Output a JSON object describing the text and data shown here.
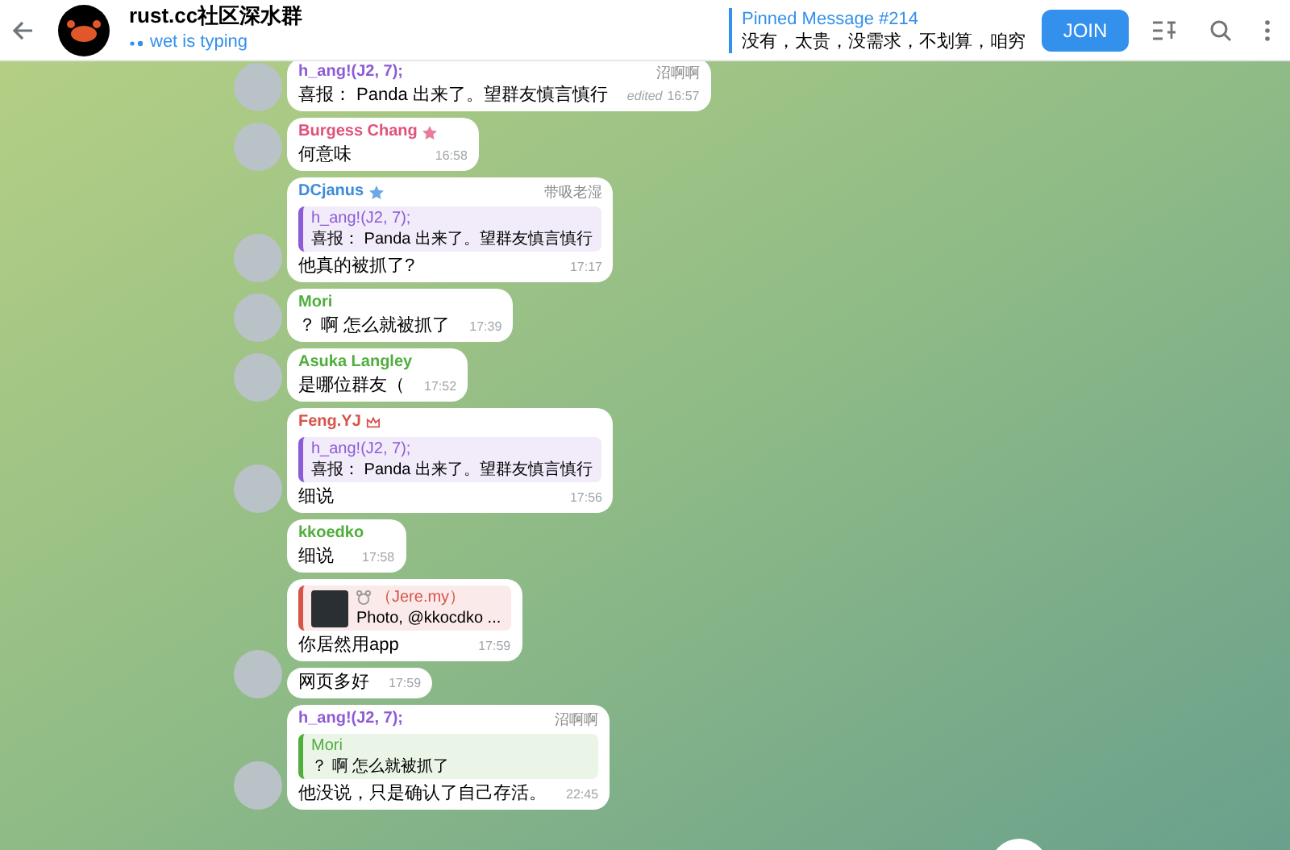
{
  "header": {
    "title": "rust.cc社区深水群",
    "status": "wet is typing",
    "pinned": {
      "label": "Pinned Message #214",
      "text": "没有，太贵，没需求，不划算，咱穷"
    },
    "join_button": "JOIN"
  },
  "messages": [
    {
      "sender": "h_ang!(J2, 7);",
      "color": "#8e5bd6",
      "star": false,
      "crown": false,
      "title": "沼啊啊",
      "text": "喜报： Panda 出来了。望群友慎言慎行",
      "edited": "edited",
      "time": "16:57",
      "avatar": true
    },
    {
      "sender": "Burgess Chang",
      "color": "#e0527a",
      "star": true,
      "crown": false,
      "text": "何意味",
      "time": "16:58",
      "avatar": true
    },
    {
      "sender": "DCjanus",
      "color": "#3e8bd8",
      "star": true,
      "crown": false,
      "title": "带吸老湿",
      "reply": {
        "sender": "h_ang!(J2, 7);",
        "color": "#8e5bd6",
        "text": "喜报： Panda 出来了。望群友慎言慎行"
      },
      "text": "他真的被抓了?",
      "time": "17:17",
      "avatar": true
    },
    {
      "sender": "Mori",
      "color": "#4fae3c",
      "star": false,
      "crown": false,
      "text": "？ 啊 怎么就被抓了",
      "time": "17:39",
      "avatar": true
    },
    {
      "sender": "Asuka Langley",
      "color": "#4fae3c",
      "star": false,
      "crown": false,
      "text": "是哪位群友（",
      "time": "17:52",
      "avatar": true
    },
    {
      "sender": "Feng.YJ",
      "color": "#d65448",
      "star": false,
      "crown": true,
      "reply": {
        "sender": "h_ang!(J2, 7);",
        "color": "#8e5bd6",
        "text": "喜报： Panda 出来了。望群友慎言慎行"
      },
      "text": "细说",
      "time": "17:56",
      "avatar": true
    },
    {
      "sender": "kkoedko",
      "color": "#4fae3c",
      "star": false,
      "crown": false,
      "text": "细说",
      "time": "17:58",
      "avatar": false
    },
    {
      "reply": {
        "sender": "（Jere.my）",
        "color": "#d65448",
        "text": "Photo, @kkocdko ...",
        "photo": true
      },
      "text": "你居然用app",
      "time": "17:59",
      "avatar": false
    },
    {
      "text": "网页多好",
      "time": "17:59",
      "avatar": true
    },
    {
      "sender": "h_ang!(J2, 7);",
      "color": "#8e5bd6",
      "star": false,
      "crown": false,
      "title": "沼啊啊",
      "reply": {
        "sender": "Mori",
        "color": "#4fae3c",
        "text": "？ 啊 怎么就被抓了"
      },
      "text": "他没说，只是确认了自己存活。",
      "time": "22:45",
      "avatar": true
    }
  ]
}
